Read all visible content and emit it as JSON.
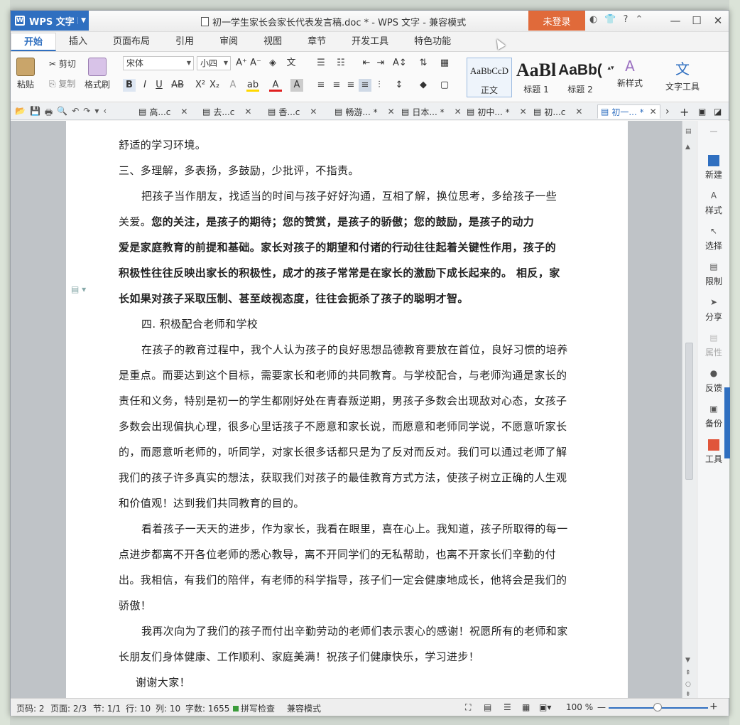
{
  "app": {
    "name": "WPS 文字"
  },
  "window": {
    "title": "初一学生家长会家长代表发言稿.doc * - WPS 文字 - 兼容模式",
    "login": "未登录"
  },
  "tabs": [
    "开始",
    "插入",
    "页面布局",
    "引用",
    "审阅",
    "视图",
    "章节",
    "开发工具",
    "特色功能"
  ],
  "ribbon": {
    "paste": "粘贴",
    "cut": "剪切",
    "copy": "复制",
    "format_painter": "格式刷",
    "font": "宋体",
    "size": "小四",
    "styles": [
      {
        "preview": "AaBbCcD",
        "label": "正文"
      },
      {
        "preview": "AaBl",
        "label": "标题 1"
      },
      {
        "preview": "AaBb(",
        "label": "标题 2"
      }
    ],
    "new_style": "新样式",
    "text_tools": "文字工具"
  },
  "doc_tabs": [
    {
      "label": "高...c",
      "active": false
    },
    {
      "label": "去...c",
      "active": false
    },
    {
      "label": "香...c",
      "active": false
    },
    {
      "label": "畅游... *",
      "active": false
    },
    {
      "label": "日本... *",
      "active": false
    },
    {
      "label": "初中... *",
      "active": false
    },
    {
      "label": "初...c",
      "active": false
    },
    {
      "label": "初一... *",
      "active": true
    }
  ],
  "document": {
    "p1": "舒适的学习环境。",
    "p2": "三、多理解，多表扬，多鼓励，少批评，不指责。",
    "p3a": "把孩子当作朋友，找适当的时间与孩子好好沟通，互相了解，换位思考，多给孩子一些",
    "p3b": "关爱。",
    "p3c": "您的关注，是孩子的期待；您的赞赏，是孩子的骄傲；您的鼓励，是孩子的动力",
    "p3d": "爱是家庭教育的前提和基础。家长对孩子的期望和付诸的行动往往起着关键性作用，孩子的",
    "p3e": "积极性往往反映出家长的积极性，成才的孩子常常是在家长的激励下成长起来的。 相反，家",
    "p3f": "长如果对孩子采取压制、甚至歧视态度，往往会扼杀了孩子的聪明才智。",
    "p4": "四. 积极配合老师和学校",
    "p5": "在孩子的教育过程中，我个人认为孩子的良好思想品德教育要放在首位，良好习惯的培养是重点。而要达到这个目标，需要家长和老师的共同教育。与学校配合，与老师沟通是家长的责任和义务，特别是初一的学生都刚好处在青春叛逆期，男孩子多数会出现敌对心态，女孩子多数会出现偏执心理，很多心里话孩子不愿意和家长说，而愿意和老师同学说，不愿意听家长的，而愿意听老师的，听同学，对家长很多话都只是为了反对而反对。我们可以通过老师了解我们的孩子许多真实的想法，获取我们对孩子的最佳教育方式方法，使孩子树立正确的人生观和价值观！达到我们共同教育的目的。",
    "p6": "看着孩子一天天的进步，作为家长，我看在眼里，喜在心上。我知道，孩子所取得的每一点进步都离不开各位老师的悉心教导，离不开同学们的无私帮助，也离不开家长们辛勤的付出。我相信，有我们的陪伴，有老师的科学指导，孩子们一定会健康地成长，他将会是我们的骄傲！",
    "p7": "我再次向为了我们的孩子而付出辛勤劳动的老师们表示衷心的感谢！祝愿所有的老师和家长朋友们身体健康、工作顺利、家庭美满！祝孩子们健康快乐，学习进步！",
    "p8": "谢谢大家！"
  },
  "taskpane": [
    "新建",
    "样式",
    "选择",
    "限制",
    "分享",
    "属性",
    "反馈",
    "备份",
    "工具"
  ],
  "status": {
    "page": "页码: 2",
    "pages": "页面: 2/3",
    "section": "节: 1/1",
    "row": "行: 10",
    "col": "列: 10",
    "words": "字数: 1655",
    "spell": "拼写检查",
    "compat": "兼容模式",
    "zoom": "100 %"
  },
  "colors": {
    "accent": "#2f6fc0",
    "login": "#e06a3a"
  }
}
